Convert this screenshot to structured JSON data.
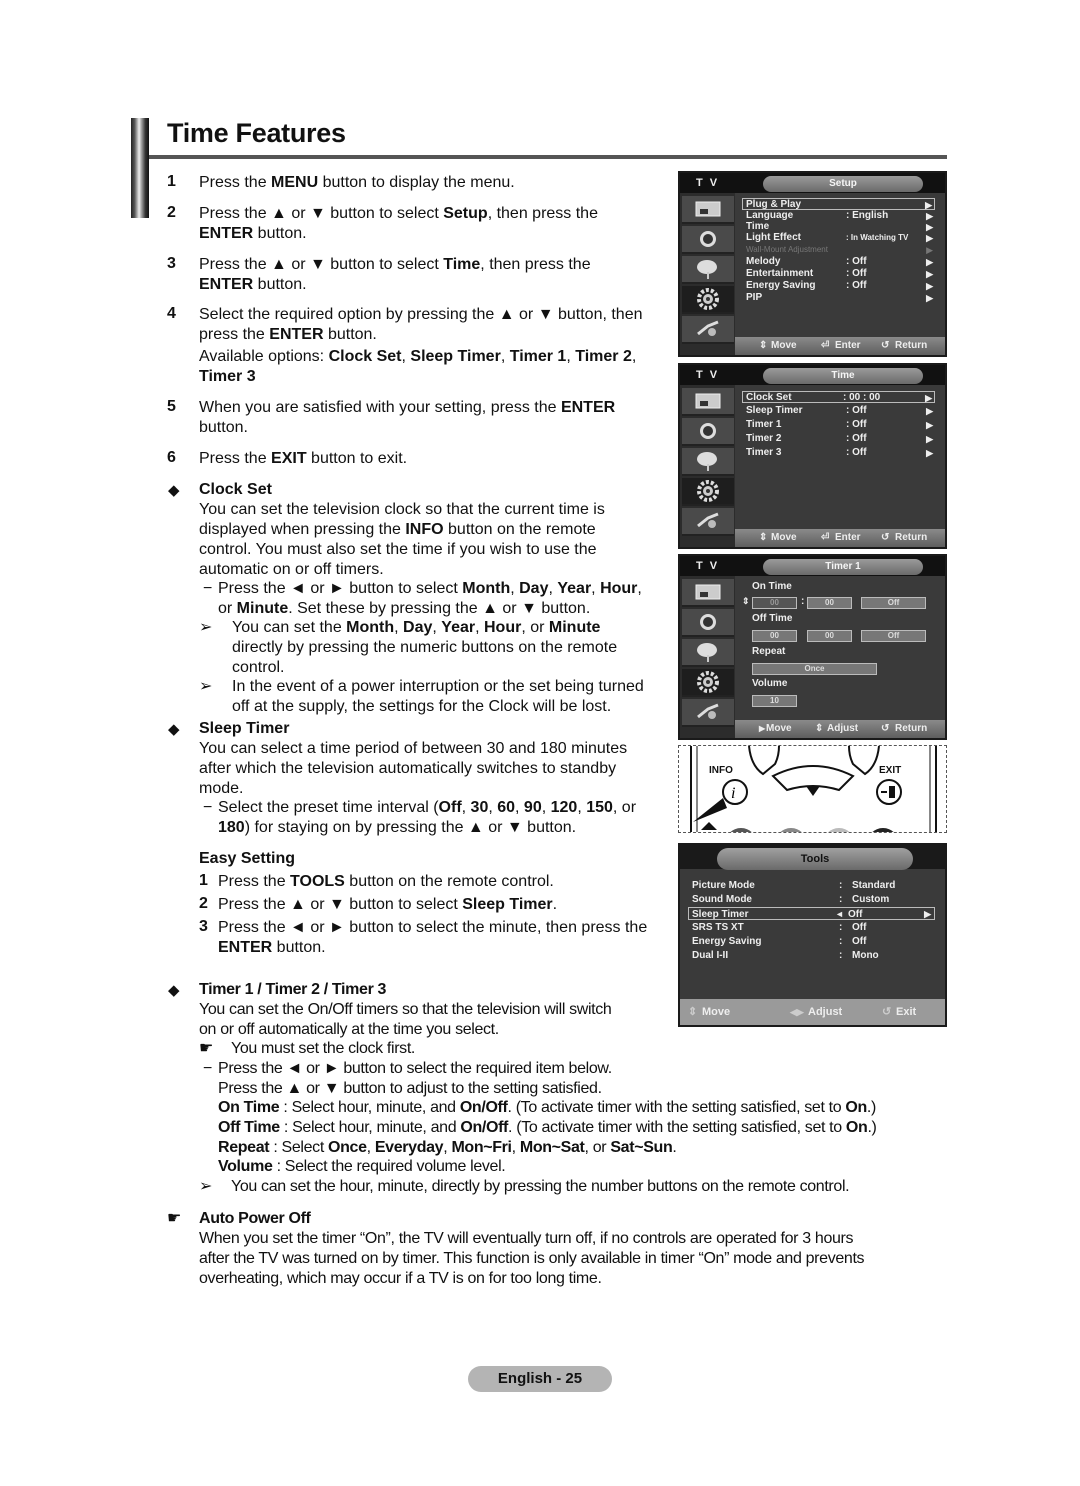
{
  "header": {
    "title": "Time Features"
  },
  "steps": [
    {
      "num": "1",
      "text_html": "Press the <b>MENU</b> button to display the menu."
    },
    {
      "num": "2",
      "text_html": "Press the ▲ or ▼ button to select <b>Setup</b>, then press the<br><b>ENTER</b> button."
    },
    {
      "num": "3",
      "text_html": "Press the ▲ or ▼ button to select <b>Time</b>, then press the<br><b>ENTER</b> button."
    },
    {
      "num": "4",
      "text_html": "Select the required option by pressing the ▲ or ▼ button, then<br>press the <b>ENTER</b> button."
    },
    {
      "num": "5",
      "text_html": "When you are satisfied with your setting, press the <b>ENTER</b><br>button."
    },
    {
      "num": "6",
      "text_html": "Press the <b>EXIT</b> button to exit."
    }
  ],
  "available_options_html": "Available options: <b>Clock Set</b>, <b>Sleep Timer</b>, <b>Timer 1</b>, <b>Timer 2</b>,<br><b>Timer 3</b>",
  "clock_set": {
    "heading": "Clock Set",
    "body_html": "You can set the television clock so that the current time is<br>displayed when pressing the <b>INFO</b> button on the remote<br>control. You must also set the time if you wish to use the<br>automatic on or off timers.",
    "dash_html": "Press the ◄ or ► button to select <b>Month</b>, <b>Day</b>, <b>Year</b>, <b>Hour</b>,<br>or <b>Minute</b>. Set these by pressing the ▲ or ▼ button.",
    "note1_html": "You can set the <b>Month</b>, <b>Day</b>, <b>Year</b>, <b>Hour</b>, or <b>Minute</b><br>directly by pressing the numeric buttons on the remote<br>control.",
    "note2_html": "In the event of a power interruption or the set being turned<br>off at the supply, the settings for the Clock will be lost."
  },
  "sleep_timer": {
    "heading": "Sleep Timer",
    "body_html": "You can select a time period of between 30 and 180 minutes<br>after which the television automatically switches to standby<br>mode.",
    "dash_html": "Select the preset time interval (<b>Off</b>, <b>30</b>, <b>60</b>, <b>90</b>, <b>120</b>, <b>150</b>, or<br><b>180</b>) for staying on by pressing the ▲ or ▼ button."
  },
  "easy_setting": {
    "heading": "Easy Setting",
    "steps": [
      {
        "num": "1",
        "text_html": "Press the <b>TOOLS</b> button on the remote control."
      },
      {
        "num": "2",
        "text_html": "Press the ▲ or ▼ button to select <b>Sleep Timer</b>."
      },
      {
        "num": "3",
        "text_html": "Press the ◄ or ► button to select the minute, then press the<br><b>ENTER</b> button."
      }
    ]
  },
  "timers": {
    "heading": "Timer 1 / Timer 2 / Timer 3",
    "body_html": "You can set the On/Off timers so that the television will switch<br>on or off automatically at the time you select.",
    "hand_note": "You must set the clock first.",
    "dash_html": "Press the ◄ or ► button to select the required item below.<br>Press the ▲ or ▼ button to adjust to the setting satisfied.",
    "on_time_html": "<b>On Time</b> : Select hour, minute, and <b>On/Off</b>. (To activate timer with the setting satisfied, set to <b>On</b>.)",
    "off_time_html": "<b>Off Time</b> : Select hour, minute, and <b>On/Off</b>. (To activate timer with the setting satisfied, set to <b>On</b>.)",
    "repeat_html": "<b>Repeat</b> : Select <b>Once</b>, <b>Everyday</b>, <b>Mon~Fri</b>, <b>Mon~Sat</b>, or <b>Sat~Sun</b>.",
    "volume_html": "<b>Volume</b> : Select the required volume level.",
    "note": "You can set the hour, minute, directly by pressing the number buttons on the remote control."
  },
  "auto_power_off": {
    "heading": "Auto Power Off",
    "body_html": "When you set the timer “On”, the TV will eventually turn off, if no controls are operated for 3 hours<br>after the TV was turned on by timer. This function is only available in timer “On” mode and prevents<br>overheating, which may occur if a TV is on for too long time."
  },
  "osd_setup": {
    "tv_label": "T V",
    "title": "Setup",
    "rows": [
      {
        "label": "Plug & Play",
        "value": ""
      },
      {
        "label": "Language",
        "value": ": English"
      },
      {
        "label": "Time",
        "value": ""
      },
      {
        "label": "Light Effect",
        "value": ": In Watching TV"
      },
      {
        "label": "Wall-Mount Adjustment",
        "value": ""
      },
      {
        "label": "Melody",
        "value": ": Off"
      },
      {
        "label": "Entertainment",
        "value": ": Off"
      },
      {
        "label": "Energy Saving",
        "value": ": Off"
      },
      {
        "label": "PIP",
        "value": ""
      }
    ],
    "footer": {
      "move": "Move",
      "enter": "Enter",
      "return": "Return"
    }
  },
  "osd_time": {
    "tv_label": "T V",
    "title": "Time",
    "rows": [
      {
        "label": "Clock Set",
        "value": ": 00 : 00"
      },
      {
        "label": "Sleep Timer",
        "value": ": Off"
      },
      {
        "label": "Timer 1",
        "value": ": Off"
      },
      {
        "label": "Timer 2",
        "value": ": Off"
      },
      {
        "label": "Timer 3",
        "value": ": Off"
      }
    ],
    "footer": {
      "move": "Move",
      "enter": "Enter",
      "return": "Return"
    }
  },
  "osd_timer1": {
    "tv_label": "T V",
    "title": "Timer 1",
    "on_time_label": "On Time",
    "on_time": {
      "hour": "00",
      "minute": "00",
      "state": "Off"
    },
    "off_time_label": "Off Time",
    "off_time": {
      "hour": "00",
      "minute": "00",
      "state": "Off"
    },
    "repeat_label": "Repeat",
    "repeat_value": "Once",
    "volume_label": "Volume",
    "volume_value": "10",
    "footer": {
      "move": "Move",
      "adjust": "Adjust",
      "return": "Return"
    }
  },
  "remote": {
    "info_label": "INFO",
    "exit_label": "EXIT"
  },
  "tools": {
    "title": "Tools",
    "rows": [
      {
        "label": "Picture Mode",
        "sep": ":",
        "value": "Standard"
      },
      {
        "label": "Sound Mode",
        "sep": ":",
        "value": "Custom"
      },
      {
        "label": "Sleep Timer",
        "sep": "◄",
        "value": "Off"
      },
      {
        "label": "SRS TS XT",
        "sep": ":",
        "value": "Off"
      },
      {
        "label": "Energy Saving",
        "sep": ":",
        "value": "Off"
      },
      {
        "label": "Dual I-II",
        "sep": ":",
        "value": "Mono"
      }
    ],
    "footer": {
      "move": "Move",
      "adjust": "Adjust",
      "exit": "Exit"
    }
  },
  "page_footer": "English - 25"
}
